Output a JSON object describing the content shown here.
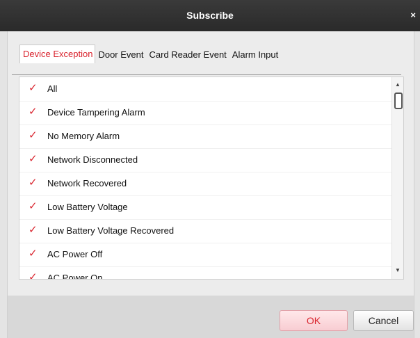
{
  "dialog": {
    "title": "Subscribe",
    "close_symbol": "×"
  },
  "tabs": [
    {
      "label": "Device Exception",
      "active": true
    },
    {
      "label": "Door Event",
      "active": false
    },
    {
      "label": "Card Reader Event",
      "active": false
    },
    {
      "label": "Alarm Input",
      "active": false
    }
  ],
  "list": {
    "items": [
      {
        "label": "All",
        "checked": true
      },
      {
        "label": "Device Tampering Alarm",
        "checked": true
      },
      {
        "label": "No Memory Alarm",
        "checked": true
      },
      {
        "label": "Network Disconnected",
        "checked": true
      },
      {
        "label": "Network Recovered",
        "checked": true
      },
      {
        "label": "Low Battery Voltage",
        "checked": true
      },
      {
        "label": "Low Battery Voltage Recovered",
        "checked": true
      },
      {
        "label": "AC Power Off",
        "checked": true
      },
      {
        "label": "AC Power On",
        "checked": true
      }
    ]
  },
  "buttons": {
    "ok": "OK",
    "cancel": "Cancel"
  },
  "colors": {
    "accent": "#d9232d",
    "titlebar": "#2f2f2f"
  }
}
